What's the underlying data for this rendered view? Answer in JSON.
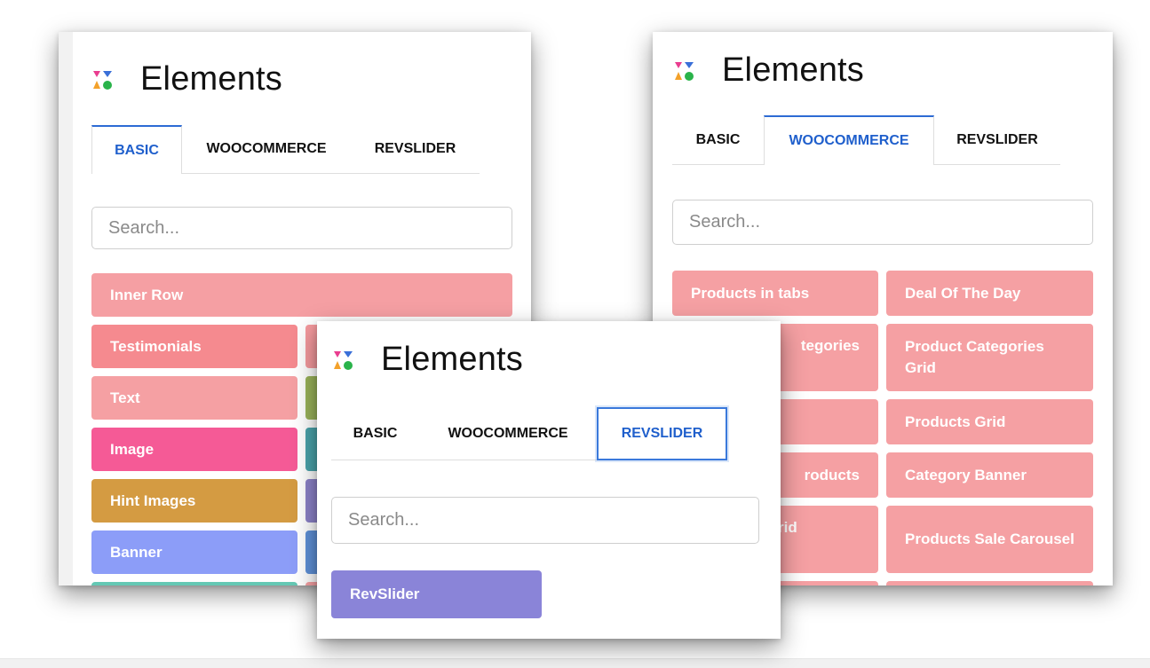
{
  "colors": {
    "pink": "#f59fa3",
    "salmon": "#f58a8f",
    "light_coral": "#f5a0a3",
    "hot_pink": "#f55a96",
    "gold": "#d49b42",
    "periwinkle": "#8c9df8",
    "olive_green": "#9ab35a",
    "teal": "#4aa3aa",
    "purple": "#8c82c8",
    "steel_blue": "#5f91d8",
    "mint": "#64c8b4",
    "revslider": "#8a84d8",
    "tab_active": "#1f5fcc"
  },
  "panel_left": {
    "title": "Elements",
    "tabs": [
      "BASIC",
      "WOOCOMMERCE",
      "REVSLIDER"
    ],
    "active_tab": "BASIC",
    "search_placeholder": "Search...",
    "elements": [
      "Inner Row",
      "Testimonials",
      "Text",
      "Image",
      "Hint Images",
      "Banner"
    ]
  },
  "panel_right": {
    "title": "Elements",
    "tabs": [
      "BASIC",
      "WOOCOMMERCE",
      "REVSLIDER"
    ],
    "active_tab": "WOOCOMMERCE",
    "search_placeholder": "Search...",
    "elements_left": [
      "Products in tabs",
      "tegories",
      "",
      "roducts",
      "rid"
    ],
    "elements_right": [
      "Deal Of The Day",
      "Product Categories Grid",
      "Products Grid",
      "Category Banner",
      "Products Sale Carousel"
    ]
  },
  "panel_center": {
    "title": "Elements",
    "tabs": [
      "BASIC",
      "WOOCOMMERCE",
      "REVSLIDER"
    ],
    "active_tab": "REVSLIDER",
    "search_placeholder": "Search...",
    "elements": [
      "RevSlider"
    ]
  }
}
